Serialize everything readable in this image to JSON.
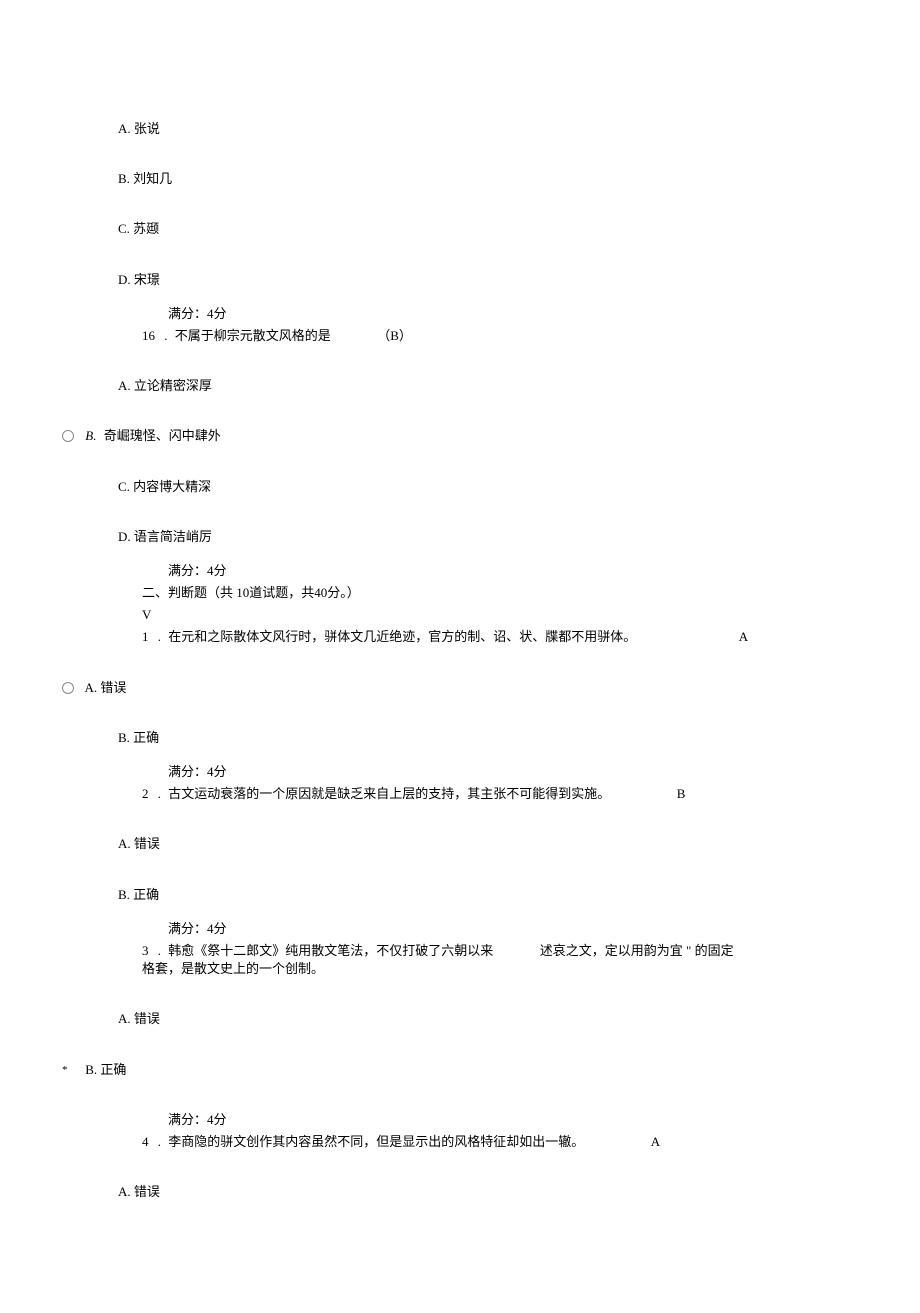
{
  "q15": {
    "optA": "A. 张说",
    "optB": "B. 刘知几",
    "optC": "C. 苏颋",
    "optD": "D. 宋璟",
    "score": "满分：4分"
  },
  "q16": {
    "num": "16",
    "dot": ".",
    "text": "不属于柳宗元散文风格的是",
    "ans": "（B）",
    "optA": "A. 立论精密深厚",
    "optB_label": "B.",
    "optB_text": "奇崛瑰怪、闪中肆外",
    "optC": "C. 内容博大精深",
    "optD": "D. 语言简洁峭厉",
    "score": "满分：4分"
  },
  "section2": {
    "title": "二、判断题（共 10道试题，共40分。）",
    "v": "V"
  },
  "j1": {
    "num": "1",
    "dot": ".",
    "text": "在元和之际散体文风行时，骈体文几近绝迹，官方的制、诏、状、牒都不用骈体。",
    "ans": "A",
    "optA": "A. 错误",
    "optB": "B. 正确",
    "score": "满分：4分"
  },
  "j2": {
    "num": "2",
    "dot": ".",
    "text": "古文运动衰落的一个原因就是缺乏来自上层的支持，其主张不可能得到实施。",
    "ans": "B",
    "optA": "A. 错误",
    "optB": "B. 正确",
    "score": "满分：4分"
  },
  "j3": {
    "num": "3",
    "dot": ".",
    "text1": "韩愈《祭十二郎文》纯用散文笔法，不仅打破了六朝以来",
    "text2": "述哀之文，定以用韵为宜 \" 的固定",
    "text3": "格套，是散文史上的一个创制。",
    "optA": "A. 错误",
    "optB": "B. 正确",
    "score": "满分：4分"
  },
  "j4": {
    "num": "4",
    "dot": ".",
    "text": "李商隐的骈文创作其内容虽然不同，但是显示出的风格特征却如出一辙。",
    "ans": "A",
    "optA": "A. 错误"
  }
}
